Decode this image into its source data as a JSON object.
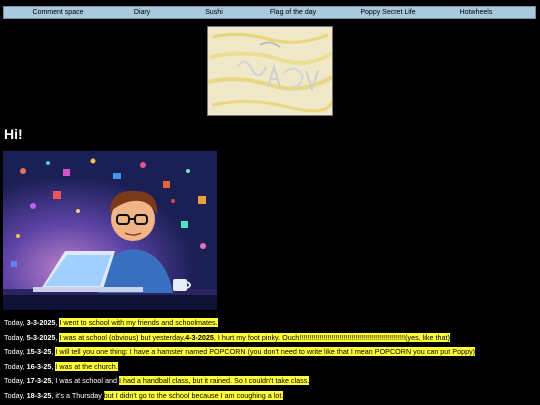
{
  "nav": {
    "items": [
      {
        "label": "Comment space"
      },
      {
        "label": "Diary"
      },
      {
        "label": "Sushi"
      },
      {
        "label": "Flag of the day"
      },
      {
        "label": "Poppy Secret Life"
      },
      {
        "label": "Hotwheels"
      }
    ]
  },
  "heading": "Hi!",
  "entries": [
    {
      "prefix": "Today, ",
      "date": "3-3-2025",
      "after": ", ",
      "highlight": "I went to school with my friends and schoolmates."
    },
    {
      "prefix": "Today, ",
      "date": "5-3-2025",
      "after": ", ",
      "highlight": "I was at school (obvious) but yesterday,",
      "date2": "4-3-2025",
      "after2": ", ",
      "highlight2": "I hurt my foot pinky. Ouch!!!!!!!!!!!!!!!!!!!!!!!!!!!!!!!!!!!!!!!!!!!!!!!!!!!!!(yes, like that)"
    },
    {
      "prefix": "Today, ",
      "date": "15-3-25",
      "after": ", ",
      "highlight": "I will tell you one thing: I have a hamster named POPCORN (you don't need to write like that I mean POPCORN you can put Poppy)"
    },
    {
      "prefix": "Today, ",
      "date": "16-3-25",
      "after": ", ",
      "highlight": "I was at the church."
    },
    {
      "prefix": "Today, ",
      "date": "17-3-25",
      "after": ", I was at school and ",
      "highlight": "I had a handball class, but it rained. So I couldn't take class."
    },
    {
      "prefix": "Today, ",
      "date": "18-3-25",
      "after": ", it's a Thursday ",
      "highlight": "but I didn't go to the school because I am coughing a lot."
    }
  ]
}
